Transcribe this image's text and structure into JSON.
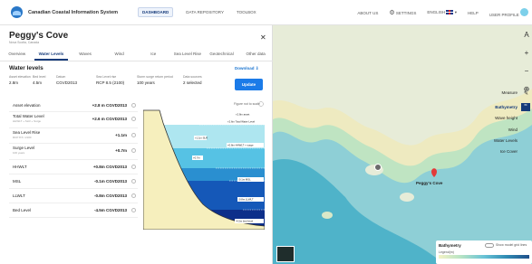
{
  "topbar": {
    "brand": "Canadian Coastal Information System",
    "nav": [
      "DASHBOARD",
      "DATA REPOSITORY",
      "TOOLBOX"
    ],
    "about": "ABOUT US",
    "settings": "SETTINGS",
    "language": "ENGLISH",
    "help": "HELP",
    "profile": "USER PROFILE"
  },
  "panel": {
    "title": "Peggy's Cove",
    "subtitle": "Nova Scotia, Canada",
    "tabs": [
      "Overview",
      "Water Levels",
      "Waves",
      "Wind",
      "Ice",
      "Sea Level Rise",
      "Geotechnical",
      "Other data"
    ],
    "active_tab": "Water Levels",
    "section": "Water levels",
    "download": "Download",
    "controls": [
      {
        "label": "Asset elevation",
        "value": "2.8m"
      },
      {
        "label": "Bed level",
        "value": "4.5m"
      },
      {
        "label": "Datum",
        "value": "CGVD2013"
      },
      {
        "label": "Sea Level rise",
        "value": "RCP 8.5 (2100)"
      },
      {
        "label": "Storm surge return period",
        "value": "100 years"
      },
      {
        "label": "Data sources",
        "value": "2 selected"
      }
    ],
    "update": "Update",
    "rows": [
      {
        "label": "Asset elevation",
        "sub": "",
        "value": "+2.8 m CGVD2013"
      },
      {
        "label": "Total Water Level",
        "sub": "HHWLT + SLR + Surge",
        "value": "+2.6 m CGVD2013"
      },
      {
        "label": "Sea Level Rise",
        "sub": "RCP 8.5 / 2100",
        "value": "+1.1m"
      },
      {
        "label": "Surge Level",
        "sub": "100 years",
        "value": "+0.7m"
      },
      {
        "label": "HHWLT",
        "sub": "",
        "value": "+0.8m CGVD2013"
      },
      {
        "label": "MSL",
        "sub": "",
        "value": "-0.1m CGVD2013"
      },
      {
        "label": "LLWLT",
        "sub": "",
        "value": "-0.8m CGVD2013"
      },
      {
        "label": "Bed Level",
        "sub": "",
        "value": "-4.5m CGVD2013"
      }
    ],
    "diagram": {
      "note": "Figure not to scale",
      "labels": [
        "+2.8m asset",
        "+2.6m Total Water Level",
        "+1.1m SLR",
        "+0.8m HHWLT + surge",
        "+0.7m",
        "-0.1m MSL",
        "-0.8m LLWLT",
        "-4.5m bed level"
      ]
    }
  },
  "map": {
    "place": "Peggy's Cove",
    "rail": [
      "A",
      "+",
      "−",
      "⊕"
    ],
    "labels": [
      "Measure",
      "Bathymetry",
      "Wave height",
      "Wind",
      "Water Levels",
      "Ice Cover"
    ],
    "legend_title": "Bathymetry",
    "legend_toggle": "Show model grid lines",
    "legend_caption": "Legend(m)",
    "colors": {
      "accent": "#1b7be8",
      "navy": "#163b7a",
      "sea": "#8ecfd6",
      "land": "#e8ecd7"
    }
  }
}
